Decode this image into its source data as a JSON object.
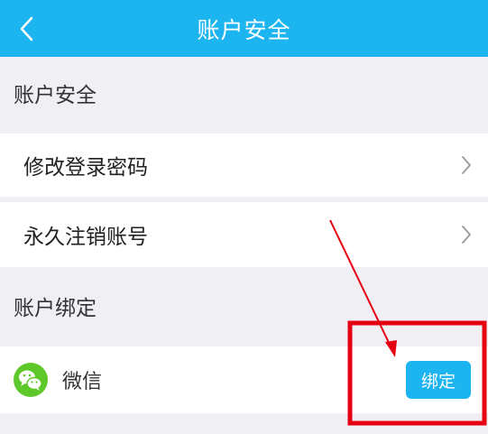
{
  "header": {
    "title": "账户安全",
    "back_icon": "chevron-left-icon"
  },
  "sections": {
    "security": {
      "label": "账户安全",
      "items": [
        {
          "label": "修改登录密码",
          "icon": "chevron-right-icon"
        },
        {
          "label": "永久注销账号",
          "icon": "chevron-right-icon"
        }
      ]
    },
    "binding": {
      "label": "账户绑定",
      "items": [
        {
          "label": "微信",
          "icon": "wechat-icon",
          "button_label": "绑定"
        }
      ]
    }
  },
  "colors": {
    "accent": "#1cb5f0",
    "wechat": "#5ec82a",
    "annotation": "#e60012",
    "background": "#efeff4"
  }
}
